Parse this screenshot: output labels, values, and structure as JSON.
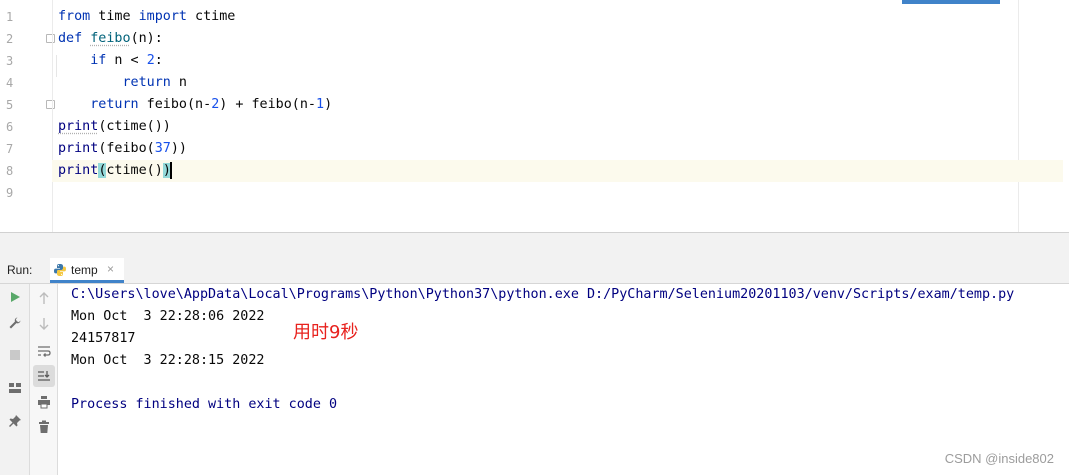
{
  "editor": {
    "line_numbers": [
      "1",
      "2",
      "3",
      "4",
      "5",
      "6",
      "7",
      "8",
      "9"
    ],
    "lines": [
      [
        {
          "t": "from",
          "c": "kw"
        },
        {
          "t": " time ",
          "c": ""
        },
        {
          "t": "import",
          "c": "kw"
        },
        {
          "t": " ctime",
          "c": ""
        }
      ],
      [
        {
          "t": "def",
          "c": "kw"
        },
        {
          "t": " ",
          "c": ""
        },
        {
          "t": "feibo",
          "c": "fn squiggle"
        },
        {
          "t": "(n):",
          "c": ""
        }
      ],
      [
        {
          "t": "    ",
          "c": ""
        },
        {
          "t": "if",
          "c": "kw"
        },
        {
          "t": " n < ",
          "c": ""
        },
        {
          "t": "2",
          "c": "num"
        },
        {
          "t": ":",
          "c": ""
        }
      ],
      [
        {
          "t": "        ",
          "c": ""
        },
        {
          "t": "return",
          "c": "kw"
        },
        {
          "t": " n",
          "c": ""
        }
      ],
      [
        {
          "t": "    ",
          "c": ""
        },
        {
          "t": "return",
          "c": "kw"
        },
        {
          "t": " feibo(n-",
          "c": ""
        },
        {
          "t": "2",
          "c": "num"
        },
        {
          "t": ") + feibo(n-",
          "c": ""
        },
        {
          "t": "1",
          "c": "num"
        },
        {
          "t": ")",
          "c": ""
        }
      ],
      [
        {
          "t": "print",
          "c": "bi squiggle"
        },
        {
          "t": "(ctime())",
          "c": ""
        }
      ],
      [
        {
          "t": "print",
          "c": "bi"
        },
        {
          "t": "(feibo(",
          "c": ""
        },
        {
          "t": "37",
          "c": "num"
        },
        {
          "t": "))",
          "c": ""
        }
      ],
      [
        {
          "t": "print",
          "c": "bi"
        },
        {
          "t": "(",
          "c": "brace-match"
        },
        {
          "t": "ctime()",
          "c": ""
        },
        {
          "t": ")",
          "c": "brace-match"
        }
      ],
      []
    ],
    "current_line": 8
  },
  "run_panel": {
    "label": "Run:",
    "tab_label": "temp",
    "tab_close": "×"
  },
  "console": {
    "command": "C:\\Users\\love\\AppData\\Local\\Programs\\Python\\Python37\\python.exe D:/PyCharm/Selenium20201103/venv/Scripts/exam/temp.py",
    "output_1": "Mon Oct  3 22:28:06 2022",
    "output_2": "24157817",
    "output_3": "Mon Oct  3 22:28:15 2022",
    "exit_message": "Process finished with exit code 0"
  },
  "annotation": "用时9秒",
  "watermark": "CSDN @inside802",
  "colors": {
    "keyword": "#0033b3",
    "number": "#1750eb",
    "builtin": "#000080",
    "accent": "#4083c9",
    "annotation": "#e8221e"
  }
}
